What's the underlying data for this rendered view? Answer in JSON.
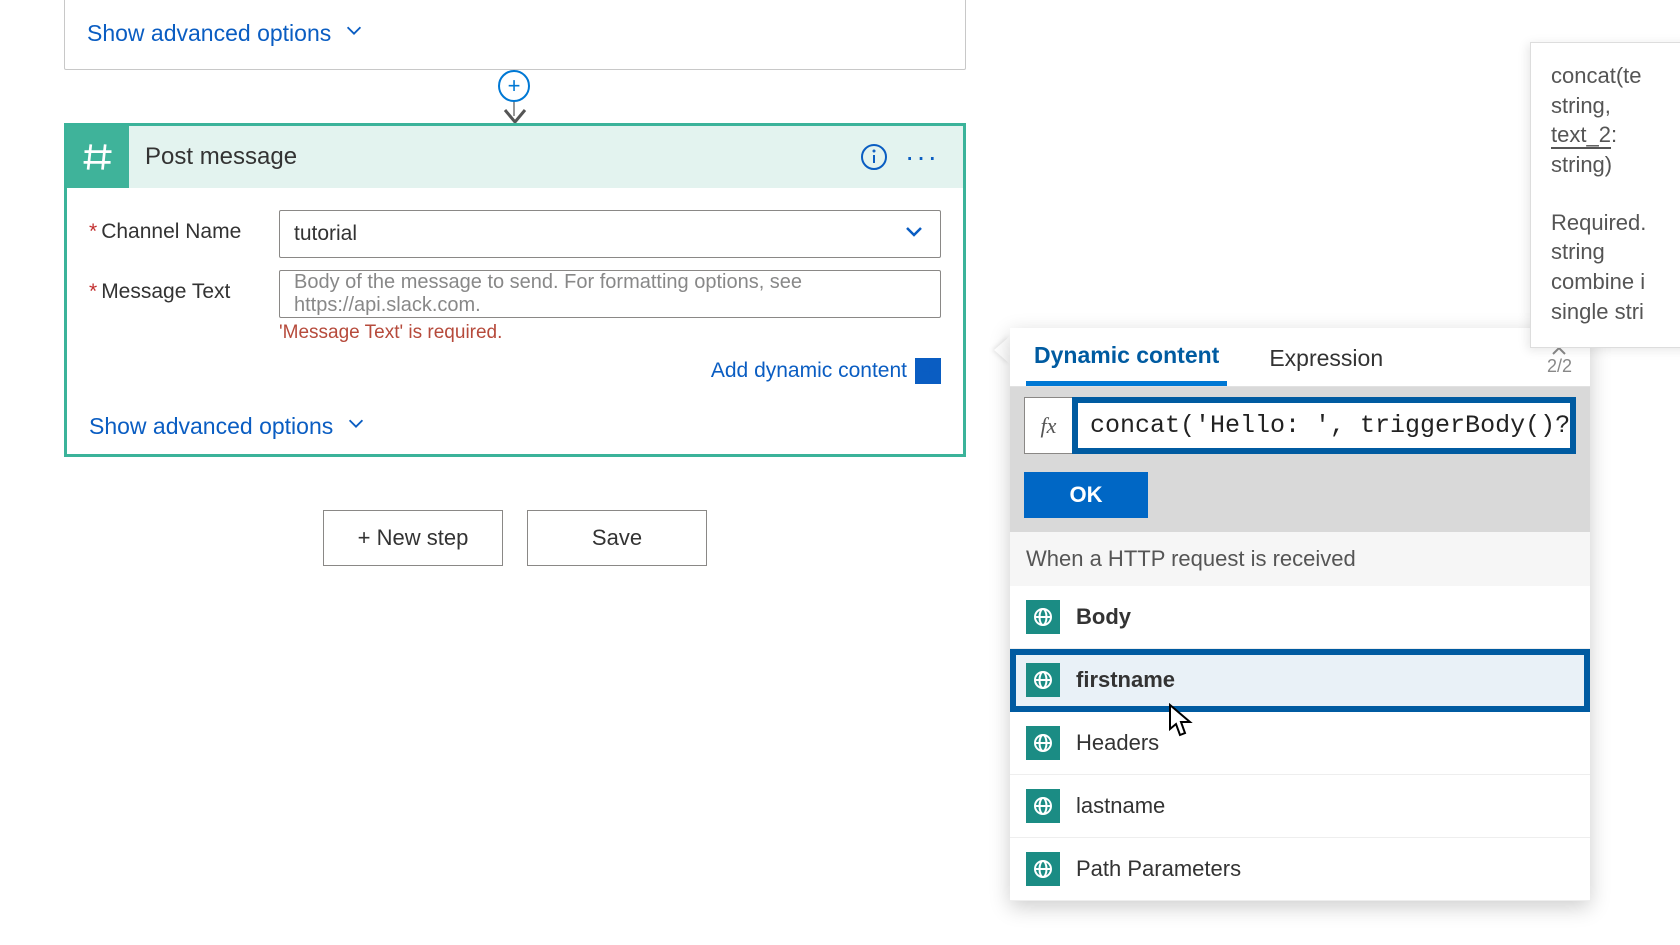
{
  "prev_card": {
    "advanced_label": "Show advanced options"
  },
  "add_button_glyph": "+",
  "card": {
    "title": "Post message",
    "fields": {
      "channel": {
        "label": "Channel Name",
        "required_mark": "*",
        "value": "tutorial"
      },
      "message": {
        "label": "Message Text",
        "required_mark": "*",
        "placeholder": "Body of the message to send. For formatting options, see https://api.slack.com.",
        "error": "'Message Text' is required."
      }
    },
    "add_dynamic_label": "Add dynamic content",
    "add_dynamic_glyph": "+",
    "advanced_label": "Show advanced options"
  },
  "buttons": {
    "new_step": "+ New step",
    "save": "Save"
  },
  "dynamic_panel": {
    "tabs": {
      "dynamic": "Dynamic content",
      "expression": "Expression"
    },
    "pager": "2/2",
    "fx_label": "fx",
    "fx_value": "concat('Hello: ', triggerBody()?['firstnam",
    "ok_label": "OK",
    "section_header": "When a HTTP request is received",
    "items": {
      "body": "Body",
      "firstname": "firstname",
      "headers": "Headers",
      "lastname": "lastname",
      "pathparams": "Path Parameters"
    }
  },
  "help": {
    "line1": "concat(te",
    "line2": "string,",
    "line3_param": "text_2",
    "line3_rest": ":",
    "line4": "string)",
    "desc1": "Required.",
    "desc2": "string",
    "desc3": "combine i",
    "desc4": "single stri",
    "combines": "ombines"
  }
}
